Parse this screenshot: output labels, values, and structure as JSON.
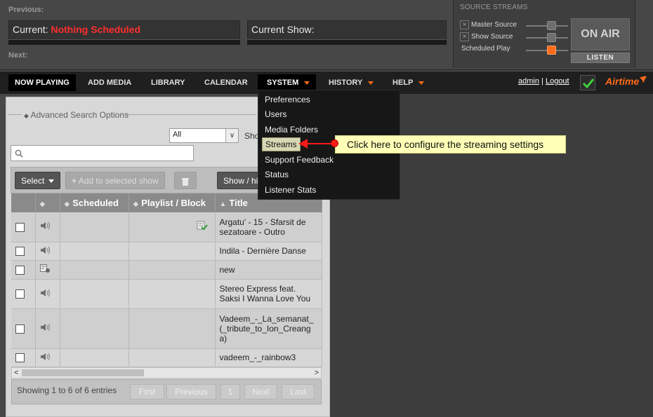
{
  "header": {
    "previous_label": "Previous:",
    "current_label": "Current:",
    "current_value": "Nothing Scheduled",
    "current_show_label": "Current Show:",
    "next_label": "Next:"
  },
  "source_streams": {
    "title": "SOURCE STREAMS",
    "rows": [
      {
        "label": "Master Source",
        "state": "off"
      },
      {
        "label": "Show Source",
        "state": "off"
      },
      {
        "label": "Scheduled Play",
        "state": "on"
      }
    ],
    "on_air_label": "ON AIR",
    "listen_label": "LISTEN"
  },
  "nav": {
    "items": [
      {
        "label": "NOW PLAYING",
        "active": true
      },
      {
        "label": "ADD MEDIA"
      },
      {
        "label": "LIBRARY"
      },
      {
        "label": "CALENDAR"
      },
      {
        "label": "SYSTEM",
        "dropdown": true,
        "open": true
      },
      {
        "label": "HISTORY",
        "dropdown": true
      },
      {
        "label": "HELP",
        "dropdown": true
      }
    ],
    "user": "admin",
    "separator": "|",
    "logout": "Logout",
    "brand": "Airtime"
  },
  "system_menu": {
    "items": [
      "Preferences",
      "Users",
      "Media Folders",
      "Streams",
      "Support Feedback",
      "Status",
      "Listener Stats"
    ],
    "highlighted": "Streams"
  },
  "callout": {
    "text": "Click here to configure the streaming settings"
  },
  "library": {
    "advanced_search_label": "Advanced Search Options",
    "filter_value": "All",
    "show_label": "Sho",
    "search_value": "",
    "toolbar": {
      "select_label": "Select",
      "add_label": "Add to selected show",
      "show_hide_label": "Show / hi"
    },
    "columns": [
      "",
      "",
      "Scheduled",
      "Playlist / Block",
      "Title"
    ],
    "rows": [
      {
        "icon": "speaker-icon",
        "scheduled": "",
        "playlist": true,
        "title": "Argatu' - 15 - Sfarsit de sezatoare - Outro"
      },
      {
        "icon": "speaker-icon",
        "scheduled": "",
        "playlist": false,
        "title": "Indila - Dernière Danse"
      },
      {
        "icon": "webstream-icon",
        "scheduled": "",
        "playlist": false,
        "title": "new"
      },
      {
        "icon": "speaker-icon",
        "scheduled": "",
        "playlist": false,
        "title": "Stereo Express feat. Saksi I Wanna Love You"
      },
      {
        "icon": "speaker-icon",
        "scheduled": "",
        "playlist": false,
        "title": "Vadeem_-_La_semanat_(_tribute_to_Ion_Creanga)"
      },
      {
        "icon": "speaker-icon",
        "scheduled": "",
        "playlist": false,
        "title": "vadeem_-_rainbow3"
      }
    ],
    "footer_info": "Showing 1 to 6 of 6 entries",
    "pagination": {
      "first": "First",
      "previous": "Previous",
      "page": "1",
      "next": "Next",
      "last": "Last"
    }
  },
  "colors": {
    "accent": "#ff6b1a",
    "alert_red": "#ff2d2d",
    "callout_bg": "#ffffb7"
  }
}
